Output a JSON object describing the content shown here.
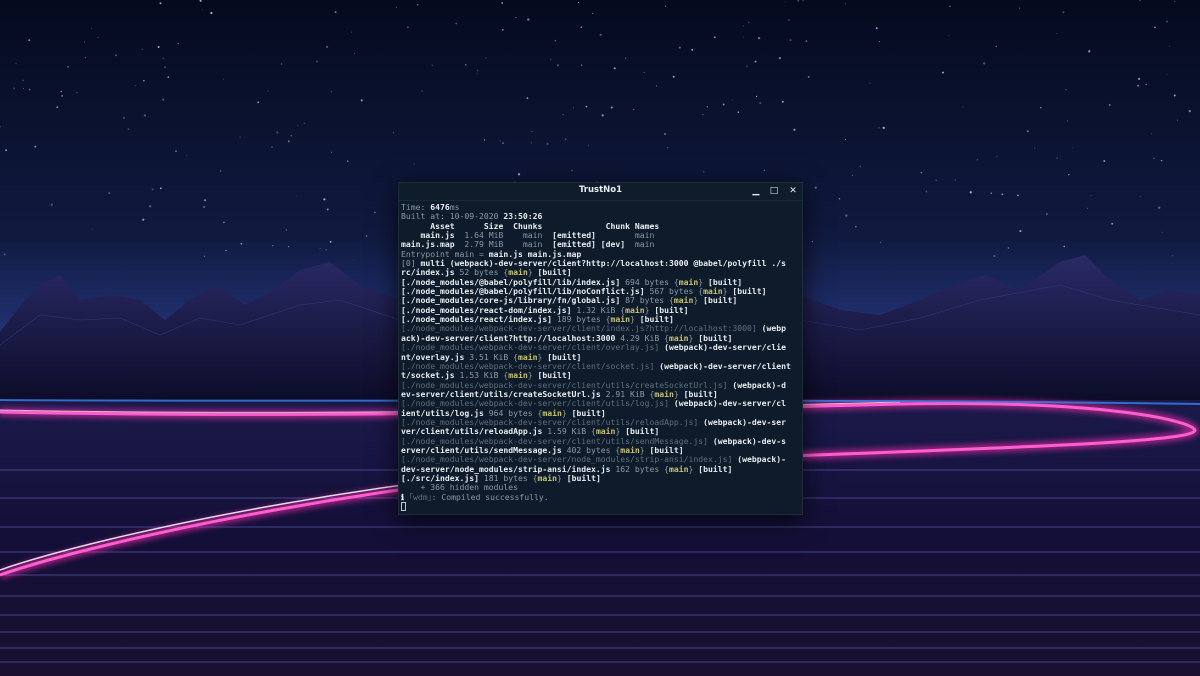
{
  "window": {
    "title": "TrustNo1",
    "minimize_icon": "minimize-icon",
    "maximize_icon": "maximize-icon",
    "close_icon": "close-icon"
  },
  "terminal": {
    "lines": [
      [
        [
          "Time: ",
          "m"
        ],
        [
          "6476",
          "fb"
        ],
        [
          "ms",
          "m"
        ]
      ],
      [
        [
          "Built at: 10-09-2020 ",
          "m"
        ],
        [
          "23:50:26",
          "fb"
        ]
      ],
      [
        [
          "      Asset      Size  Chunks             Chunk Names",
          "fb"
        ]
      ],
      [
        [
          "    main.js",
          "fb"
        ],
        [
          "  1.64 MiB",
          "m"
        ],
        [
          "    main  ",
          "m"
        ],
        [
          "[emitted]",
          "fb"
        ],
        [
          "        main",
          "m"
        ]
      ],
      [
        [
          "main.js.map",
          "fb"
        ],
        [
          "  2.79 MiB",
          "m"
        ],
        [
          "    main  ",
          "m"
        ],
        [
          "[emitted]",
          "fb"
        ],
        [
          " [dev]",
          "fb"
        ],
        [
          "  main",
          "m"
        ]
      ],
      [
        [
          "Entrypoint main = ",
          "m"
        ],
        [
          "main.js main.js.map",
          "fb"
        ]
      ],
      [
        [
          "[0] ",
          "m"
        ],
        [
          "multi (webpack)-dev-server/client?http://localhost:3000 @babel/polyfill ./s",
          "fb"
        ]
      ],
      [
        [
          "rc/index.js",
          "fb"
        ],
        [
          " 52 bytes {",
          "m"
        ],
        [
          "main",
          "y"
        ],
        [
          "} ",
          "m"
        ],
        [
          "[built]",
          "fb"
        ]
      ],
      [
        [
          "[./node_modules/@babel/polyfill/lib/index.js]",
          "fb"
        ],
        [
          " 694 bytes {",
          "m"
        ],
        [
          "main",
          "y"
        ],
        [
          "} ",
          "m"
        ],
        [
          "[built]",
          "fb"
        ]
      ],
      [
        [
          "[./node_modules/@babel/polyfill/lib/noConflict.js]",
          "fb"
        ],
        [
          " 567 bytes {",
          "m"
        ],
        [
          "main",
          "y"
        ],
        [
          "} ",
          "m"
        ],
        [
          "[built]",
          "fb"
        ]
      ],
      [
        [
          "[./node_modules/core-js/library/fn/global.js]",
          "fb"
        ],
        [
          " 87 bytes {",
          "m"
        ],
        [
          "main",
          "y"
        ],
        [
          "} ",
          "m"
        ],
        [
          "[built]",
          "fb"
        ]
      ],
      [
        [
          "[./node_modules/react-dom/index.js]",
          "fb"
        ],
        [
          " 1.32 KiB {",
          "m"
        ],
        [
          "main",
          "y"
        ],
        [
          "} ",
          "m"
        ],
        [
          "[built]",
          "fb"
        ]
      ],
      [
        [
          "[./node_modules/react/index.js]",
          "fb"
        ],
        [
          " 189 bytes {",
          "m"
        ],
        [
          "main",
          "y"
        ],
        [
          "} ",
          "m"
        ],
        [
          "[built]",
          "fb"
        ]
      ],
      [
        [
          "[./node_modules/webpack-dev-server/client/index.js?http://localhost:3000]",
          "g"
        ],
        [
          " (webp",
          "fb"
        ]
      ],
      [
        [
          "ack)-dev-server/client?http://localhost:3000",
          "fb"
        ],
        [
          " 4.29 KiB {",
          "m"
        ],
        [
          "main",
          "y"
        ],
        [
          "} ",
          "m"
        ],
        [
          "[built]",
          "fb"
        ]
      ],
      [
        [
          "[./node_modules/webpack-dev-server/client/overlay.js]",
          "g"
        ],
        [
          " (webpack)-dev-server/clie",
          "fb"
        ]
      ],
      [
        [
          "nt/overlay.js",
          "fb"
        ],
        [
          " 3.51 KiB {",
          "m"
        ],
        [
          "main",
          "y"
        ],
        [
          "} ",
          "m"
        ],
        [
          "[built]",
          "fb"
        ]
      ],
      [
        [
          "[./node_modules/webpack-dev-server/client/socket.js]",
          "g"
        ],
        [
          " (webpack)-dev-server/client",
          "fb"
        ]
      ],
      [
        [
          "t/socket.js",
          "fb"
        ],
        [
          " 1.53 KiB {",
          "m"
        ],
        [
          "main",
          "y"
        ],
        [
          "} ",
          "m"
        ],
        [
          "[built]",
          "fb"
        ]
      ],
      [
        [
          "[./node_modules/webpack-dev-server/client/utils/createSocketUrl.js]",
          "g"
        ],
        [
          " (webpack)-d",
          "fb"
        ]
      ],
      [
        [
          "ev-server/client/utils/createSocketUrl.js",
          "fb"
        ],
        [
          " 2.91 KiB {",
          "m"
        ],
        [
          "main",
          "y"
        ],
        [
          "} ",
          "m"
        ],
        [
          "[built]",
          "fb"
        ]
      ],
      [
        [
          "[./node_modules/webpack-dev-server/client/utils/log.js]",
          "g"
        ],
        [
          " (webpack)-dev-server/cl",
          "fb"
        ]
      ],
      [
        [
          "ient/utils/log.js",
          "fb"
        ],
        [
          " 964 bytes {",
          "m"
        ],
        [
          "main",
          "y"
        ],
        [
          "} ",
          "m"
        ],
        [
          "[built]",
          "fb"
        ]
      ],
      [
        [
          "[./node_modules/webpack-dev-server/client/utils/reloadApp.js]",
          "g"
        ],
        [
          " (webpack)-dev-ser",
          "fb"
        ]
      ],
      [
        [
          "ver/client/utils/reloadApp.js",
          "fb"
        ],
        [
          " 1.59 KiB {",
          "m"
        ],
        [
          "main",
          "y"
        ],
        [
          "} ",
          "m"
        ],
        [
          "[built]",
          "fb"
        ]
      ],
      [
        [
          "[./node_modules/webpack-dev-server/client/utils/sendMessage.js]",
          "g"
        ],
        [
          " (webpack)-dev-s",
          "fb"
        ]
      ],
      [
        [
          "erver/client/utils/sendMessage.js",
          "fb"
        ],
        [
          " 402 bytes {",
          "m"
        ],
        [
          "main",
          "y"
        ],
        [
          "} ",
          "m"
        ],
        [
          "[built]",
          "fb"
        ]
      ],
      [
        [
          "[./node_modules/webpack-dev-server/node_modules/strip-ansi/index.js]",
          "g"
        ],
        [
          " (webpack)-",
          "fb"
        ]
      ],
      [
        [
          "dev-server/node_modules/strip-ansi/index.js",
          "fb"
        ],
        [
          " 162 bytes {",
          "m"
        ],
        [
          "main",
          "y"
        ],
        [
          "} ",
          "m"
        ],
        [
          "[built]",
          "fb"
        ]
      ],
      [
        [
          "[./src/index.js]",
          "fb"
        ],
        [
          " 181 bytes {",
          "m"
        ],
        [
          "main",
          "y"
        ],
        [
          "} ",
          "m"
        ],
        [
          "[built]",
          "fb"
        ]
      ],
      [
        [
          "    + 366 hidden modules",
          "m"
        ]
      ],
      [
        [
          "ℹ ",
          "fb"
        ],
        [
          "｢wdm｣",
          "g"
        ],
        [
          ": Compiled successfully.",
          "m"
        ]
      ]
    ]
  },
  "colors": {
    "terminal_bg": "#0d1b2a",
    "neon_pink": "#ff2fb4",
    "neon_blue": "#3f8fff",
    "sky_top": "#050a1e"
  }
}
